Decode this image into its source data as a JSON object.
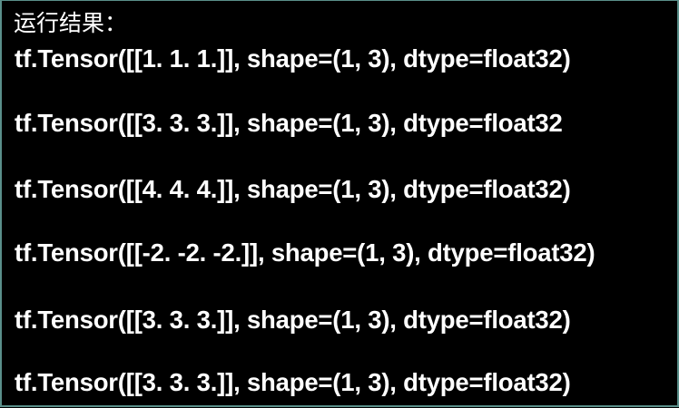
{
  "colors": {
    "background": "#000000",
    "text": "#ffffff",
    "border": "#5a8f8a"
  },
  "heading": "运行结果：",
  "output_lines": [
    "tf.Tensor([[1. 1. 1.]], shape=(1, 3), dtype=float32)",
    "tf.Tensor([[3. 3. 3.]], shape=(1, 3), dtype=float32",
    "tf.Tensor([[4. 4. 4.]], shape=(1, 3), dtype=float32)",
    "tf.Tensor([[-2. -2. -2.]], shape=(1, 3), dtype=float32)",
    "tf.Tensor([[3. 3. 3.]], shape=(1, 3), dtype=float32)",
    "tf.Tensor([[3. 3. 3.]], shape=(1, 3), dtype=float32)"
  ]
}
